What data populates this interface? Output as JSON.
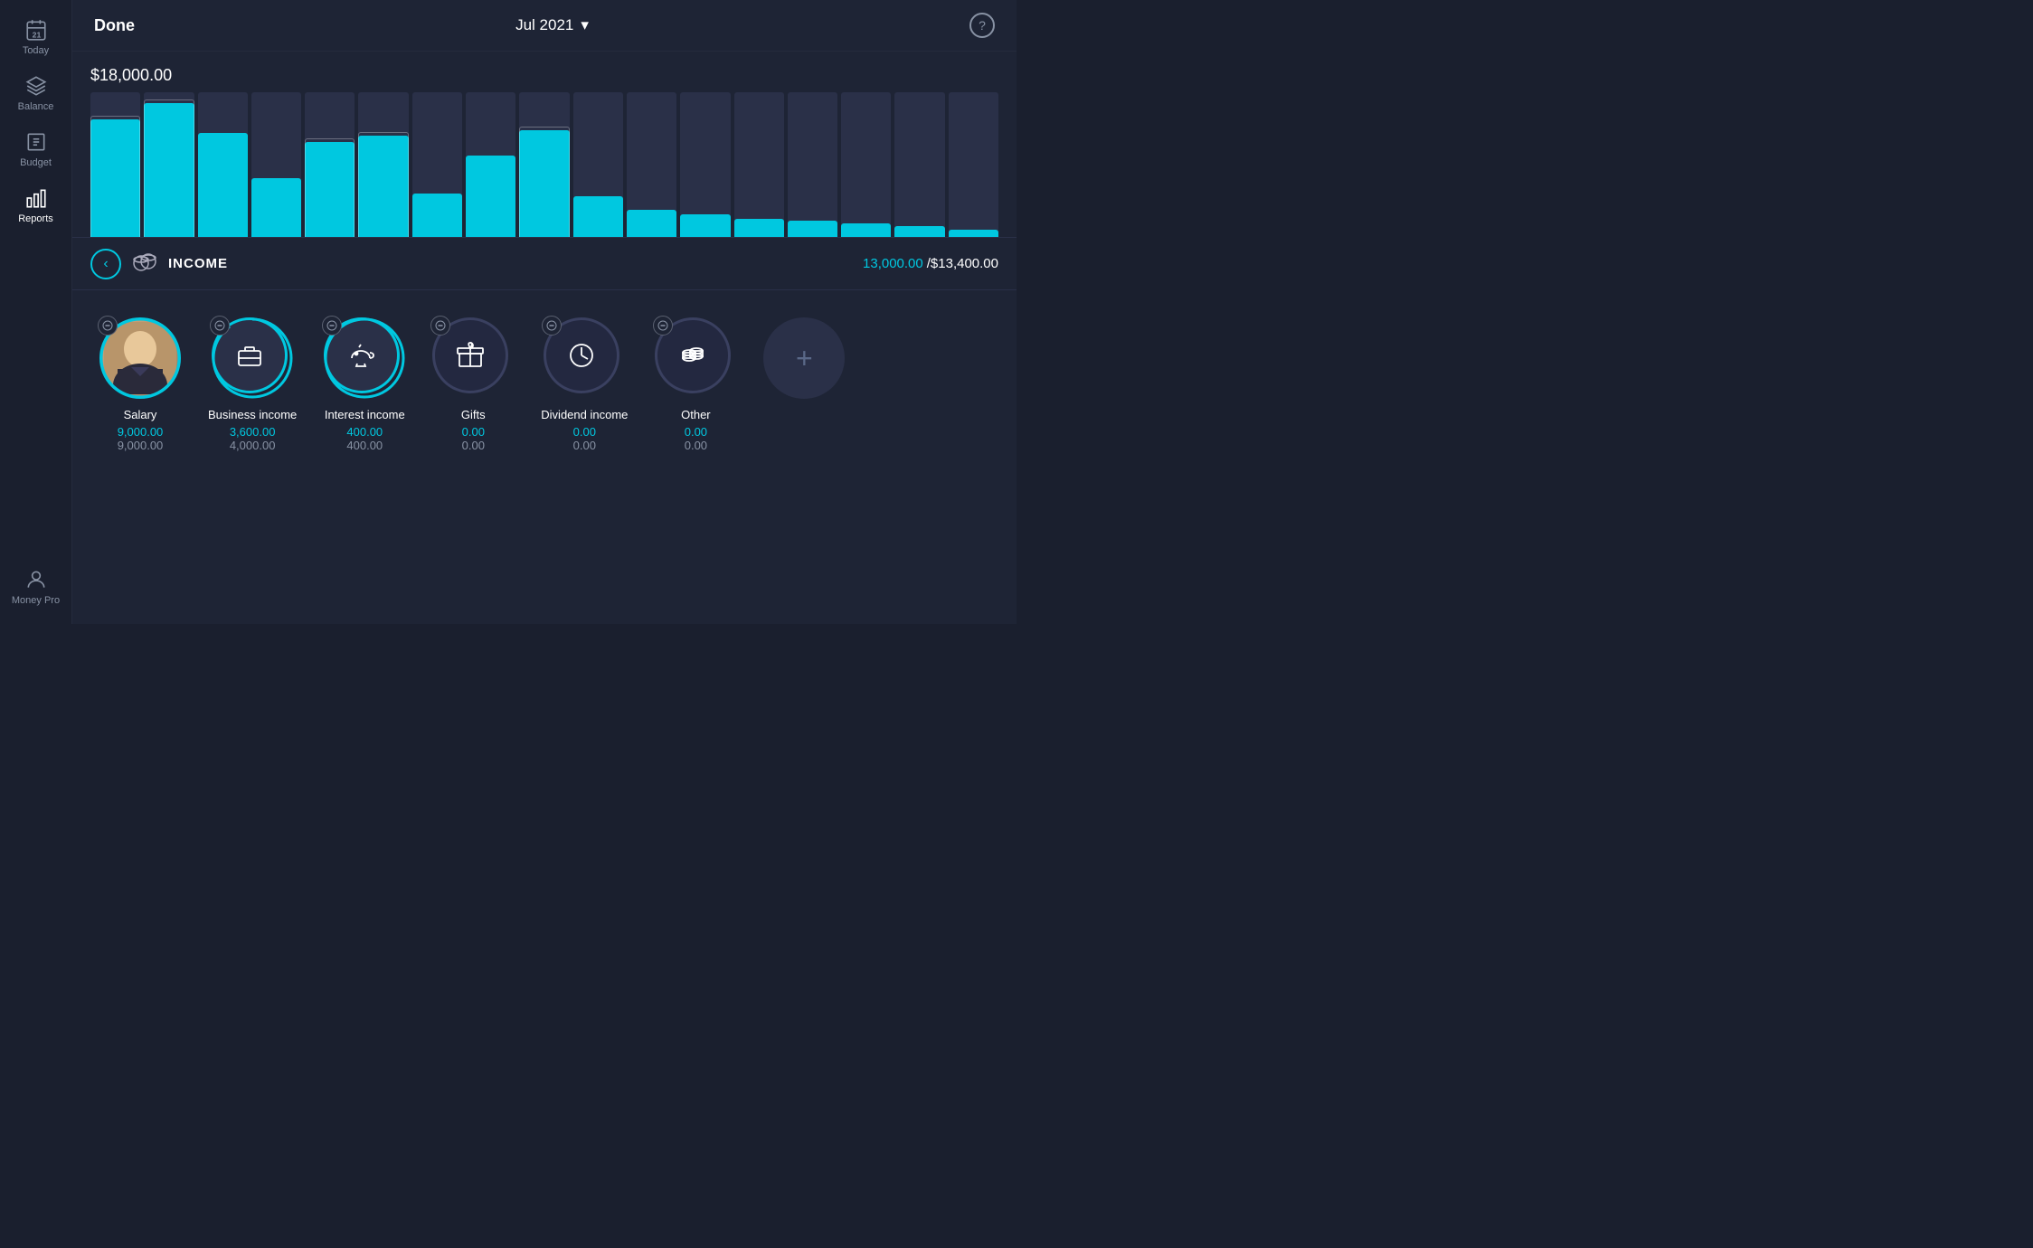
{
  "app": {
    "name": "Money Pro"
  },
  "header": {
    "done_label": "Done",
    "title": "Jul 2021",
    "chevron": "▾",
    "help_icon": "?"
  },
  "chart": {
    "amount_label": "$18,000.00",
    "bars": [
      {
        "bg": 100,
        "fill": 85,
        "has_outline": true
      },
      {
        "bg": 100,
        "fill": 92,
        "has_outline": true
      },
      {
        "bg": 100,
        "fill": 78,
        "has_outline": false
      },
      {
        "bg": 100,
        "fill": 45,
        "has_outline": false
      },
      {
        "bg": 100,
        "fill": 68,
        "has_outline": true
      },
      {
        "bg": 100,
        "fill": 72,
        "has_outline": true
      },
      {
        "bg": 100,
        "fill": 32,
        "has_outline": false
      },
      {
        "bg": 100,
        "fill": 60,
        "has_outline": false
      },
      {
        "bg": 100,
        "fill": 75,
        "has_outline": true
      },
      {
        "bg": 100,
        "fill": 30,
        "has_outline": false
      },
      {
        "bg": 100,
        "fill": 20,
        "has_outline": false
      },
      {
        "bg": 100,
        "fill": 18,
        "has_outline": false
      },
      {
        "bg": 100,
        "fill": 15,
        "has_outline": false
      },
      {
        "bg": 100,
        "fill": 12,
        "has_outline": false
      },
      {
        "bg": 100,
        "fill": 10,
        "has_outline": false
      },
      {
        "bg": 100,
        "fill": 8,
        "has_outline": false
      },
      {
        "bg": 100,
        "fill": 6,
        "has_outline": false
      }
    ]
  },
  "income": {
    "back_icon": "‹",
    "label": "INCOME",
    "actual": "13,000.00",
    "separator": " / ",
    "budget": "$13,400.00"
  },
  "sidebar": {
    "items": [
      {
        "id": "today",
        "label": "Today"
      },
      {
        "id": "balance",
        "label": "Balance"
      },
      {
        "id": "budget",
        "label": "Budget"
      },
      {
        "id": "reports",
        "label": "Reports"
      }
    ],
    "bottom": {
      "label": "Money Pro"
    }
  },
  "categories": [
    {
      "id": "salary",
      "name": "Salary",
      "actual": "9,000.00",
      "budget": "9,000.00",
      "type": "avatar",
      "has_ring": true,
      "ring_pct": 100
    },
    {
      "id": "business-income",
      "name": "Business income",
      "actual": "3,600.00",
      "budget": "4,000.00",
      "type": "briefcase",
      "has_ring": true,
      "ring_pct": 90
    },
    {
      "id": "interest-income",
      "name": "Interest income",
      "actual": "400.00",
      "budget": "400.00",
      "type": "piggy",
      "has_ring": true,
      "ring_pct": 100
    },
    {
      "id": "gifts",
      "name": "Gifts",
      "actual": "0.00",
      "budget": "0.00",
      "type": "gift",
      "has_ring": false
    },
    {
      "id": "dividend-income",
      "name": "Dividend income",
      "actual": "0.00",
      "budget": "0.00",
      "type": "clock",
      "has_ring": false
    },
    {
      "id": "other",
      "name": "Other",
      "actual": "0.00",
      "budget": "0.00",
      "type": "coins",
      "has_ring": false
    }
  ],
  "add_button": {
    "label": "+"
  }
}
